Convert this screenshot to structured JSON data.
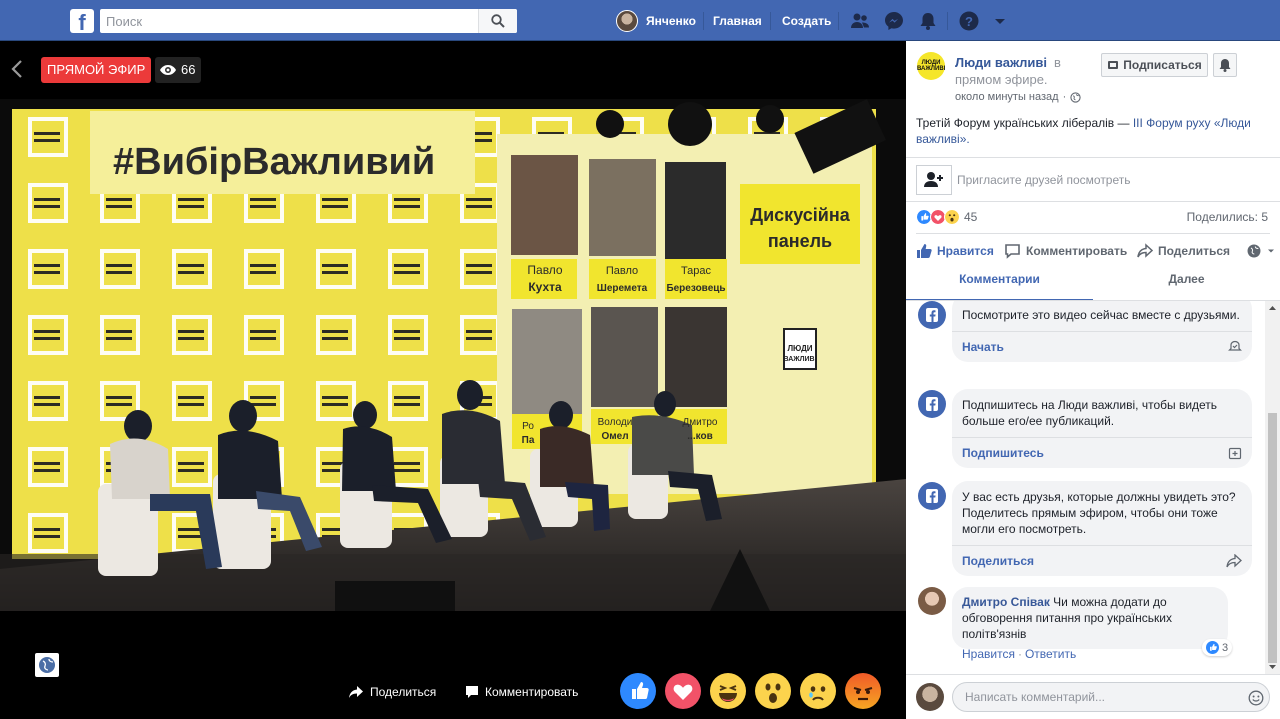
{
  "topbar": {
    "logo": "f",
    "search_placeholder": "Поиск",
    "user_name": "Янченко",
    "nav_home": "Главная",
    "nav_create": "Создать",
    "icons": [
      "friends-icon",
      "messenger-icon",
      "notifications-icon",
      "help-icon",
      "dropdown-caret-icon"
    ]
  },
  "video": {
    "live_label": "ПРЯМОЙ ЭФИР",
    "viewer_count": "66",
    "screen": {
      "hashtag": "#ВибірВажливий",
      "panel_title_line1": "Дискусійна",
      "panel_title_line2": "панель",
      "logo_line1": "ЛЮДИ",
      "logo_line2": "ВАЖЛИВІ",
      "speakers": [
        {
          "first": "Павло",
          "last": "Кухта"
        },
        {
          "first": "Павло",
          "last": "Шеремета"
        },
        {
          "first": "Тарас",
          "last": "Березовець"
        },
        {
          "first": "Ро",
          "last": "Па"
        },
        {
          "first": "Володи",
          "last": "Омел"
        },
        {
          "first": "Дмитро",
          "last": "...ков"
        }
      ]
    },
    "footer": {
      "share_label": "Поделиться",
      "comment_label": "Комментировать",
      "reactions": [
        "like",
        "love",
        "haha",
        "wow",
        "sad",
        "angry"
      ]
    }
  },
  "sidebar": {
    "page_logo_line1": "ЛЮДИ",
    "page_logo_line2": "ВАЖЛИВІ",
    "page_name": "Люди важливі",
    "page_name_suffix": "в",
    "live_status": "прямом эфире.",
    "timestamp": "около минуты назад",
    "subscribe_label": "Подписаться",
    "description_text": "Третій Форум українських лібералів —",
    "description_link": "ІІІ Форум руху «Люди важливі».",
    "invite_label": "Пригласите друзей посмотреть",
    "reactions_count": "45",
    "shares_label": "Поделились: 5",
    "actions": {
      "like": "Нравится",
      "comment": "Комментировать",
      "share": "Поделиться"
    },
    "tabs": [
      "Комментарии",
      "Далее"
    ],
    "prompts": [
      {
        "text": "Посмотрите это видео сейчас вместе с друзьями.",
        "link": "Начать"
      },
      {
        "text": "Подпишитесь на Люди важливі, чтобы видеть больше его/ее публикаций.",
        "link": "Подпишитесь"
      },
      {
        "text": "У вас есть друзья, которые должны увидеть это? Поделитесь прямым эфиром, чтобы они тоже могли его посмотреть.",
        "link": "Поделиться"
      }
    ],
    "comment": {
      "author": "Дмитро Співак",
      "text": "Чи можна додати до обговорення питання про українських політв'язнів",
      "likes": "3",
      "like_action": "Нравится",
      "reply_action": "Ответить"
    },
    "composer_placeholder": "Написать комментарий..."
  },
  "colors": {
    "brand_blue": "#4267b2",
    "live_red": "#ec3a3a",
    "stage_yellow": "#f5e62a"
  }
}
